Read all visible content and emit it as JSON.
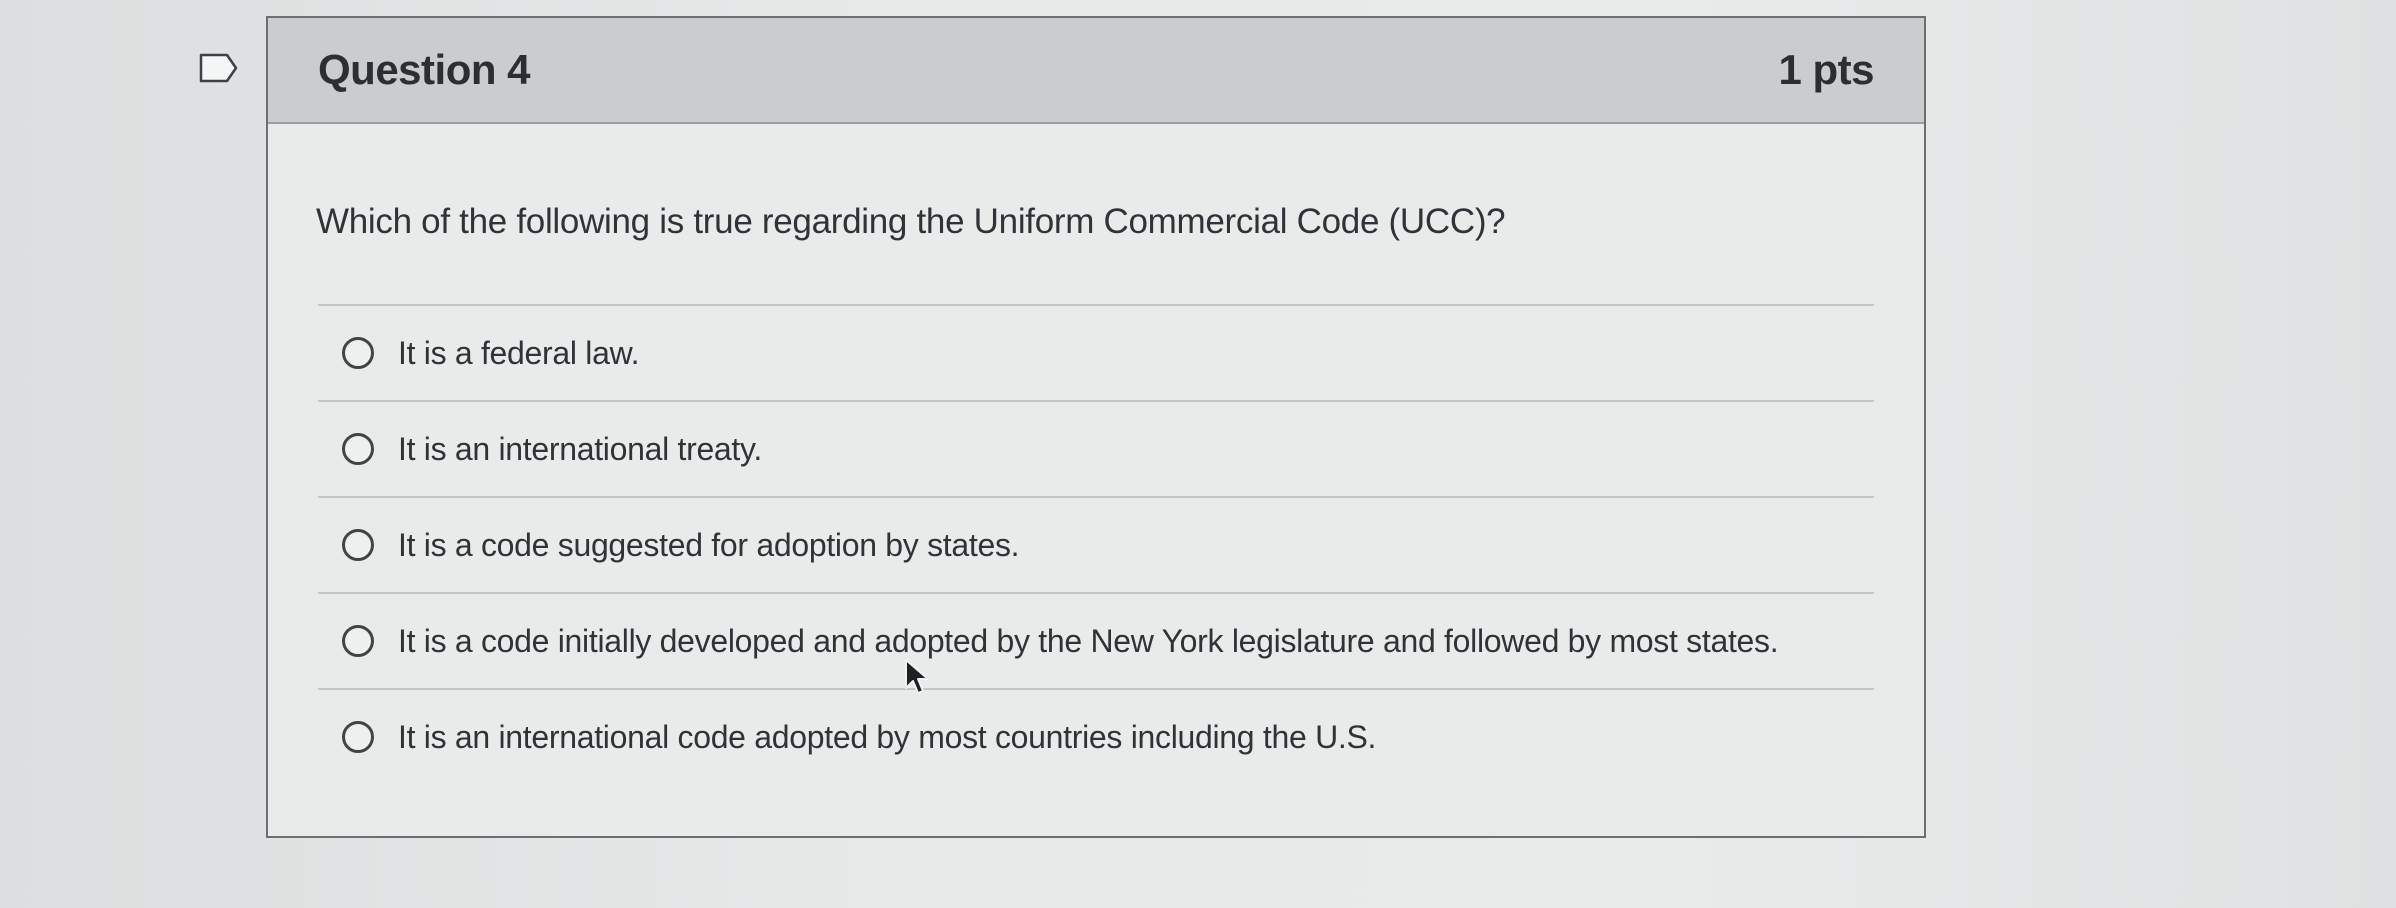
{
  "question": {
    "title": "Question 4",
    "points": "1 pts",
    "text": "Which of the following is true regarding the Uniform Commercial Code (UCC)?",
    "flag_icon": "bookmark-flag-icon",
    "answers": [
      {
        "label": "It is a federal law.",
        "selected": false
      },
      {
        "label": "It is an international treaty.",
        "selected": false
      },
      {
        "label": "It is a code suggested for adoption by states.",
        "selected": false
      },
      {
        "label": "It is a code initially developed and adopted by the New York legislature and followed by most states.",
        "selected": false
      },
      {
        "label": "It is an international code adopted by most countries including the U.S.",
        "selected": false
      }
    ]
  },
  "colors": {
    "header_bg": "#c9cdce",
    "card_border": "#6b6f72",
    "text": "#2f3338"
  }
}
